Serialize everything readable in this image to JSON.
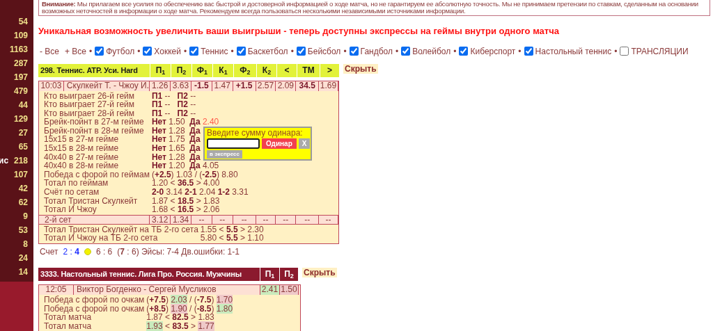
{
  "sidebar": {
    "items": [
      {
        "count": "54"
      },
      {
        "count": "109"
      },
      {
        "count": "1163"
      },
      {
        "count": "287"
      },
      {
        "count": "197"
      },
      {
        "count": "479"
      },
      {
        "count": "44"
      },
      {
        "count": "129"
      },
      {
        "count": "27"
      },
      {
        "count": "65"
      },
      {
        "label": "ис",
        "count": "218"
      },
      {
        "count": "107"
      },
      {
        "count": "42"
      },
      {
        "count": "62"
      },
      {
        "count": "9"
      },
      {
        "count": "53"
      },
      {
        "count": "8"
      },
      {
        "count": "24"
      },
      {
        "count": "14"
      }
    ]
  },
  "notice": {
    "lines": [
      "**Внимание:** Мы прилагаем все усилия по обеспечению вас быстрой и достоверной информацией о ходе матча, но не гарантируем ее абсолютную точность. Мы не принимаем претензии по ставкам, сделанным на основании",
      "возможных неточностей в информации о ходе матча. Рекомендуем всегда пользоваться несколькими независимыми источниками информации."
    ]
  },
  "headline": "Уникальная возможность увеличить ваши выигрыши - теперь доступны экспрессы на геймы внутри одного матча",
  "filter_bar": {
    "collapse_all": "- Все",
    "expand_all": "+ Все",
    "filters": [
      {
        "sep": "•",
        "label": "Футбол",
        "checked": true
      },
      {
        "sep": "•",
        "label": "Хоккей",
        "checked": true
      },
      {
        "sep": "•",
        "label": "Теннис",
        "checked": true
      },
      {
        "sep": "•",
        "label": "Баскетбол",
        "checked": true
      },
      {
        "sep": "•",
        "label": "Бейсбол",
        "checked": true
      },
      {
        "sep": "•",
        "label": "Гандбол",
        "checked": true
      },
      {
        "sep": "•",
        "label": "Волейбол",
        "checked": true
      },
      {
        "sep": "•",
        "label": "Киберспорт",
        "checked": true
      },
      {
        "sep": "•",
        "label": "Настольный теннис",
        "checked": true
      },
      {
        "sep": "•",
        "label": "ТРАНСЛЯЦИИ",
        "checked": false
      }
    ]
  },
  "events": [
    {
      "color": "#e2f23a",
      "title": "298. Теннис. ATP. Уси. Hard",
      "columns": [
        "П$_{1}$",
        "П$_{2}$",
        "Ф$_{1}$",
        "К$_{1}$",
        "Ф$_{2}$",
        "К$_{2}$",
        "<",
        "ТМ",
        ">"
      ],
      "hide": "Скрыть",
      "match": {
        "time": "10:03",
        "players": "Скулкейт Т. - Чжоу И.",
        "odds": [
          {
            "kind": "t",
            "text": "1.26"
          },
          {
            "kind": "t",
            "text": "3.63"
          },
          {
            "kind": "b",
            "text": "-1.5"
          },
          {
            "kind": "t",
            "text": "1.47"
          },
          {
            "kind": "b",
            "text": "+1.5"
          },
          {
            "kind": "t",
            "text": "2.57"
          },
          {
            "kind": "t",
            "text": "2.09"
          },
          {
            "kind": "b",
            "text": "34.5"
          },
          {
            "kind": "t",
            "text": "1.69"
          }
        ]
      },
      "sections": [
        {
          "markets": [
            {
              "label": "Кто выиграет 26-й гейм",
              "parts": [
                {
                  "kind": "b",
                  "text": "П1"
                },
                {
                  "kind": "t",
                  "text": " --   "
                },
                {
                  "kind": "b",
                  "text": "П2"
                },
                {
                  "kind": "t",
                  "text": " --"
                }
              ]
            },
            {
              "label": "Кто выиграет 27-й гейм",
              "parts": [
                {
                  "kind": "b",
                  "text": "П1"
                },
                {
                  "kind": "t",
                  "text": " --   "
                },
                {
                  "kind": "b",
                  "text": "П2"
                },
                {
                  "kind": "t",
                  "text": " --"
                }
              ]
            },
            {
              "label": "Кто выиграет 28-й гейм",
              "parts": [
                {
                  "kind": "b",
                  "text": "П1"
                },
                {
                  "kind": "t",
                  "text": " --   "
                },
                {
                  "kind": "b",
                  "text": "П2"
                },
                {
                  "kind": "t",
                  "text": " --"
                }
              ]
            },
            {
              "label": "Брейк-пойнт в 27-м гейме",
              "parts": [
                {
                  "kind": "b",
                  "text": "Нет"
                },
                {
                  "kind": "t",
                  "text": " 1.50  "
                },
                {
                  "kind": "b",
                  "text": "Да"
                },
                {
                  "kind": "hi",
                  "text": " 2.40"
                }
              ]
            },
            {
              "label": "Брейк-пойнт в 28-м гейме",
              "parts": [
                {
                  "kind": "b",
                  "text": "Нет"
                },
                {
                  "kind": "t",
                  "text": " 1.28  "
                },
                {
                  "kind": "b",
                  "text": "Да"
                }
              ]
            },
            {
              "label": "15x15 в 27-м гейме",
              "parts": [
                {
                  "kind": "b",
                  "text": "Нет"
                },
                {
                  "kind": "t",
                  "text": " 1.75  "
                },
                {
                  "kind": "b",
                  "text": "Да"
                }
              ]
            },
            {
              "label": "15x15 в 28-м гейме",
              "parts": [
                {
                  "kind": "b",
                  "text": "Нет"
                },
                {
                  "kind": "t",
                  "text": " 1.65  "
                },
                {
                  "kind": "b",
                  "text": "Да"
                }
              ]
            },
            {
              "label": "40x40 в 27-м гейме",
              "parts": [
                {
                  "kind": "b",
                  "text": "Нет"
                },
                {
                  "kind": "t",
                  "text": " 1.28  "
                },
                {
                  "kind": "b",
                  "text": "Да"
                }
              ]
            },
            {
              "label": "40x40 в 28-м гейме",
              "parts": [
                {
                  "kind": "b",
                  "text": "Нет"
                },
                {
                  "kind": "t",
                  "text": " 1.20  "
                },
                {
                  "kind": "b",
                  "text": "Да"
                },
                {
                  "kind": "t",
                  "text": " 4.05"
                }
              ]
            },
            {
              "label": "Победа с форой по геймам",
              "parts": [
                {
                  "kind": "t",
                  "text": "("
                },
                {
                  "kind": "b",
                  "text": "+2.5"
                },
                {
                  "kind": "t",
                  "text": ") 1.03 / ("
                },
                {
                  "kind": "b",
                  "text": "-2.5"
                },
                {
                  "kind": "t",
                  "text": ") 8.80"
                }
              ]
            },
            {
              "label": "Тотал по геймам",
              "parts": [
                {
                  "kind": "t",
                  "text": "1.20 < "
                },
                {
                  "kind": "b",
                  "text": "36.5"
                },
                {
                  "kind": "t",
                  "text": " > 4.00"
                }
              ]
            },
            {
              "label": "Счёт по сетам",
              "parts": [
                {
                  "kind": "b",
                  "text": "2-0"
                },
                {
                  "kind": "t",
                  "text": " 3.14 "
                },
                {
                  "kind": "b",
                  "text": "2-1"
                },
                {
                  "kind": "t",
                  "text": " 2.04 "
                },
                {
                  "kind": "b",
                  "text": "1-2"
                },
                {
                  "kind": "t",
                  "text": " 3.31"
                }
              ]
            },
            {
              "label": "Тотал Тристан Скулкейт",
              "parts": [
                {
                  "kind": "t",
                  "text": "1.87 < "
                },
                {
                  "kind": "b",
                  "text": "18.5"
                },
                {
                  "kind": "t",
                  "text": " > 1.83"
                }
              ]
            },
            {
              "label": "Тотал И Чжоу",
              "parts": [
                {
                  "kind": "t",
                  "text": "1.68 < "
                },
                {
                  "kind": "b",
                  "text": "16.5"
                },
                {
                  "kind": "t",
                  "text": " > 2.06"
                }
              ]
            }
          ]
        },
        {
          "period": {
            "label": "2-й сет",
            "cells": [
              "3.12",
              "1.34",
              "--",
              "--",
              "--",
              "--",
              "--",
              "--",
              "--"
            ]
          },
          "markets": [
            {
              "label": "Тотал Тристан Скулкейт на ТБ 2-го сета",
              "parts": [
                {
                  "kind": "t",
                  "text": "1.55 < "
                },
                {
                  "kind": "b",
                  "text": "5.5"
                },
                {
                  "kind": "t",
                  "text": " > 2.30"
                }
              ]
            },
            {
              "label": "Тотал И Чжоу на ТБ 2-го сета",
              "parts": [
                {
                  "kind": "t",
                  "text": "5.80 < "
                },
                {
                  "kind": "b",
                  "text": "5.5"
                },
                {
                  "kind": "t",
                  "text": " > 1.10"
                }
              ]
            }
          ]
        }
      ],
      "bet_popup": {
        "prompt": "Введите сумму одинара:",
        "single_button": "Одинар",
        "close_button": "X",
        "express_button": "в экспресс"
      },
      "score": [
        {
          "kind": "t",
          "text": "Счет"
        },
        {
          "kind": "blue",
          "text": "2 : **4**"
        },
        {
          "kind": "dot"
        },
        {
          "kind": "t",
          "text": "6 : 6"
        },
        {
          "kind": "t",
          "text": "(**7** : 6) Эйсы: 7-4 Дв.ошибки: 1-1"
        }
      ]
    },
    {
      "color": "#8b1a2e",
      "title": "3333. Настольный теннис. Лига Про. Россия. Мужчины",
      "columns": [
        "П$_{1}$",
        "П$_{2}$"
      ],
      "hide": "Скрыть",
      "match": {
        "time": "12:05",
        "players": "Виктор Богденко - Сергей Мусликов",
        "odds": [
          {
            "kind": "up",
            "text": "2.41"
          },
          {
            "kind": "down",
            "text": "1.50"
          }
        ]
      },
      "sections": [
        {
          "markets": [
            {
              "label": "Победа с форой по очкам",
              "parts": [
                {
                  "kind": "t",
                  "text": "("
                },
                {
                  "kind": "b",
                  "text": "+7.5"
                },
                {
                  "kind": "t",
                  "text": ") "
                },
                {
                  "kind": "up",
                  "text": "2.03"
                },
                {
                  "kind": "t",
                  "text": " / ("
                },
                {
                  "kind": "b",
                  "text": "-7.5"
                },
                {
                  "kind": "t",
                  "text": ") "
                },
                {
                  "kind": "down",
                  "text": "1.70"
                }
              ]
            },
            {
              "label": "Победа с форой по очкам",
              "parts": [
                {
                  "kind": "t",
                  "text": "("
                },
                {
                  "kind": "b",
                  "text": "+8.5"
                },
                {
                  "kind": "t",
                  "text": ") "
                },
                {
                  "kind": "down",
                  "text": "1.90"
                },
                {
                  "kind": "t",
                  "text": " / ("
                },
                {
                  "kind": "b",
                  "text": "-8.5"
                },
                {
                  "kind": "t",
                  "text": ") "
                },
                {
                  "kind": "up",
                  "text": "1.80"
                }
              ]
            },
            {
              "label": "Тотал матча",
              "parts": [
                {
                  "kind": "t",
                  "text": "1.87 < "
                },
                {
                  "kind": "b",
                  "text": "82.5"
                },
                {
                  "kind": "t",
                  "text": " > 1.83"
                }
              ]
            },
            {
              "label": "Тотал матча",
              "parts": [
                {
                  "kind": "up",
                  "text": "1.93"
                },
                {
                  "kind": "t",
                  "text": " < "
                },
                {
                  "kind": "b",
                  "text": "83.5"
                },
                {
                  "kind": "t",
                  "text": " > "
                },
                {
                  "kind": "down",
                  "text": "1.77"
                }
              ]
            }
          ]
        }
      ]
    }
  ]
}
